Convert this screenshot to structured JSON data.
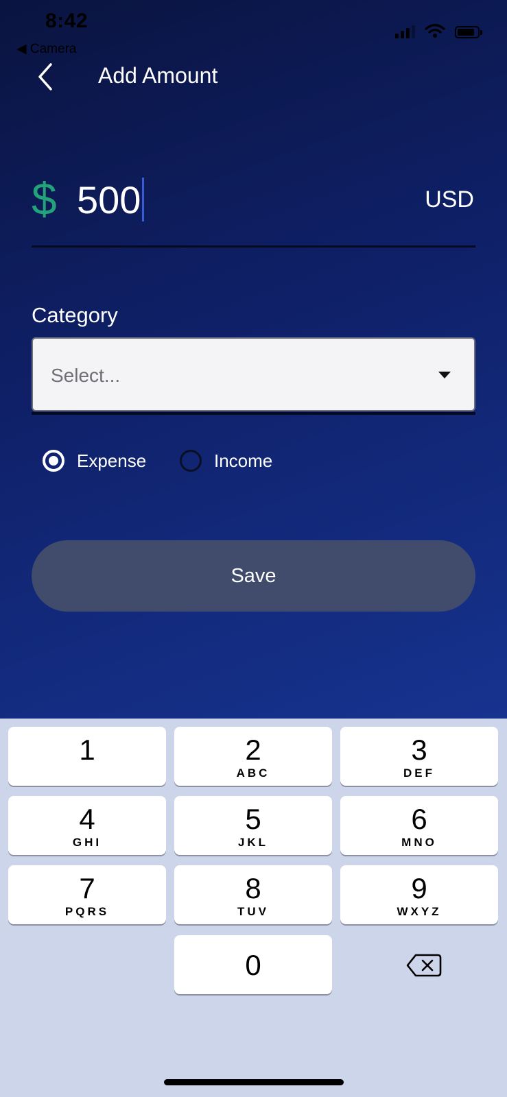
{
  "status_bar": {
    "time": "8:42",
    "back_app": "◀ Camera"
  },
  "header": {
    "title": "Add Amount"
  },
  "amount": {
    "symbol": "$",
    "value": "500",
    "currency": "USD"
  },
  "category": {
    "label": "Category",
    "placeholder": "Select..."
  },
  "type_options": [
    {
      "label": "Expense",
      "selected": true
    },
    {
      "label": "Income",
      "selected": false
    }
  ],
  "save_label": "Save",
  "keypad": {
    "keys": [
      {
        "num": "1",
        "letters": ""
      },
      {
        "num": "2",
        "letters": "ABC"
      },
      {
        "num": "3",
        "letters": "DEF"
      },
      {
        "num": "4",
        "letters": "GHI"
      },
      {
        "num": "5",
        "letters": "JKL"
      },
      {
        "num": "6",
        "letters": "MNO"
      },
      {
        "num": "7",
        "letters": "PQRS"
      },
      {
        "num": "8",
        "letters": "TUV"
      },
      {
        "num": "9",
        "letters": "WXYZ"
      },
      {
        "num": "0",
        "letters": ""
      }
    ]
  },
  "colors": {
    "accent_dollar": "#22a37a",
    "save_button": "#414c6c",
    "keypad_bg": "#cdd5ea"
  },
  "icons": {
    "back": "chevron-left-icon",
    "dropdown": "caret-down-icon",
    "delete": "backspace-icon",
    "signal": "cellular-signal-icon",
    "wifi": "wifi-icon",
    "battery": "battery-icon"
  }
}
